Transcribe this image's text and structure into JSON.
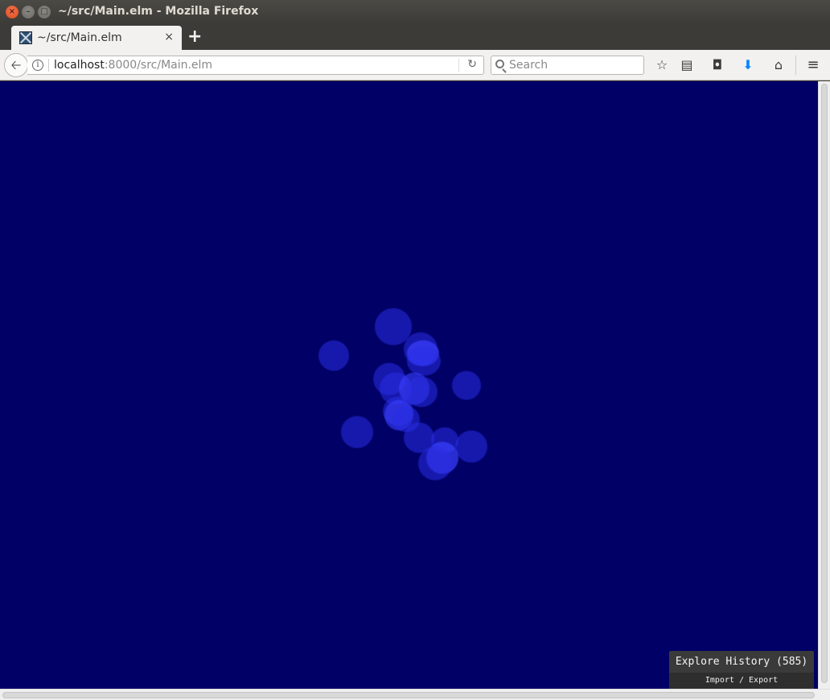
{
  "window": {
    "title": "~/src/Main.elm - Mozilla Firefox"
  },
  "tab": {
    "label": "~/src/Main.elm",
    "close": "×",
    "new_tab": "+"
  },
  "navbar": {
    "url_host": "localhost",
    "url_rest": ":8000/src/Main.elm",
    "search_placeholder": "Search"
  },
  "page": {
    "background": "#000066",
    "particle_color": "#2a2ee6"
  },
  "debugger": {
    "history_label": "Explore History (585)",
    "import_export": "Import / Export"
  },
  "icons": [
    "close-icon",
    "minimize-icon",
    "maximize-icon",
    "back-arrow-icon",
    "info-icon",
    "reload-icon",
    "search-icon",
    "bookmark-star-icon",
    "reading-list-icon",
    "pocket-icon",
    "download-icon",
    "home-icon",
    "menu-icon"
  ]
}
